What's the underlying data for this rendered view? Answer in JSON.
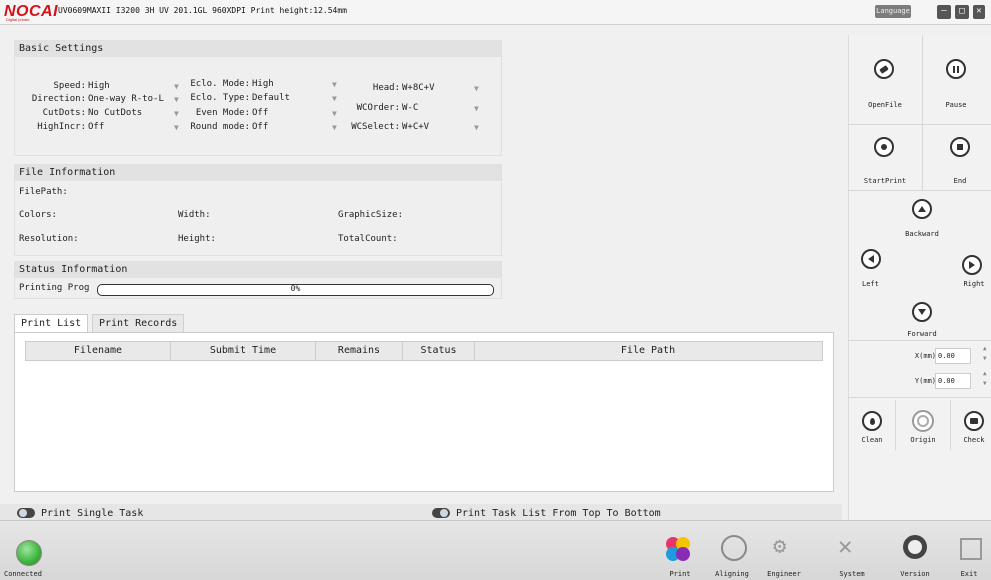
{
  "title_bar": {
    "logo": "NOCAI",
    "logo_sub": "Digital printer",
    "text": "UV0609MAXII I3200 3H UV 201.1GL 960XDPI Print height:12.54mm",
    "language_btn": "Language",
    "min_icon": "minimize-icon",
    "max_icon": "maximize-icon",
    "close_icon": "close-icon"
  },
  "basic_settings": {
    "header": "Basic Settings",
    "col1": [
      {
        "label": "Speed:",
        "value": "High"
      },
      {
        "label": "Direction:",
        "value": "One-way R-to-L"
      },
      {
        "label": "CutDots:",
        "value": "No CutDots"
      },
      {
        "label": "HighIncr:",
        "value": "Off"
      }
    ],
    "col2": [
      {
        "label": "Eclo. Mode:",
        "value": "High"
      },
      {
        "label": "Eclo. Type:",
        "value": "Default"
      },
      {
        "label": "Even Mode:",
        "value": "Off"
      },
      {
        "label": "Round mode:",
        "value": "Off"
      }
    ],
    "col3": [
      {
        "label": "Head:",
        "value": "W+8C+V"
      },
      {
        "label": "WCOrder:",
        "value": "W-C"
      },
      {
        "label": "WCSelect:",
        "value": "W+C+V"
      }
    ],
    "dropdown_arrow": "▼"
  },
  "file_info": {
    "header": "File Information",
    "filepath_label": "FilePath:",
    "colors_label": "Colors:",
    "width_label": "Width:",
    "graphicsize_label": "GraphicSize:",
    "resolution_label": "Resolution:",
    "height_label": "Height:",
    "totalcount_label": "TotalCount:"
  },
  "status_info": {
    "header": "Status Information",
    "printing_label": "Printing Prog",
    "progress_text": "0%",
    "progress_value": 0
  },
  "tabs": {
    "print_list": "Print List",
    "print_records": "Print Records"
  },
  "table": {
    "columns": [
      "Filename",
      "Submit Time",
      "Remains",
      "Status",
      "File Path"
    ]
  },
  "toggles": {
    "single_task": "Print Single Task",
    "top_to_bottom": "Print Task List From Top To Bottom"
  },
  "right_panel": {
    "open_file": "OpenFile",
    "pause": "Pause",
    "start_print": "StartPrint",
    "end": "End",
    "backward": "Backward",
    "left": "Left",
    "right": "Right",
    "forward": "Forward",
    "x_label": "X(mm)",
    "x_value": "0.00",
    "y_label": "Y(mm)",
    "y_value": "0.00",
    "clean": "Clean",
    "origin": "Origin",
    "check": "Check"
  },
  "bottom_bar": {
    "connected": "Connected",
    "print": "Print",
    "aligning": "Aligning",
    "engineer": "Engineer",
    "system": "System",
    "version": "Version",
    "exit": "Exit"
  },
  "colors": {
    "brand_red": "#d4121b",
    "connected_green": "#3cb43c",
    "progress_blue": "#4a90d9"
  }
}
